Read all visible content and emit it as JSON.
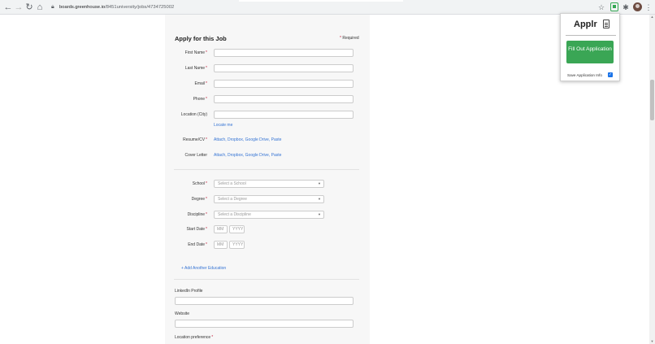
{
  "browser": {
    "url_host": "boards.greenhouse.io",
    "url_path": "/8451university/jobs/4734725002",
    "icons": [
      "back-arrow-icon",
      "forward-arrow-icon",
      "reload-icon",
      "home-icon",
      "lock-icon",
      "star-icon",
      "puzzle-icon",
      "menu-icon"
    ]
  },
  "form": {
    "title": "Apply for this Job",
    "required_note": "Required",
    "required_mark": "*",
    "fields": {
      "first_name": "First Name",
      "last_name": "Last Name",
      "email": "Email",
      "phone": "Phone",
      "location": "Location (City)"
    },
    "locate_me": "Locate me",
    "resume_label": "Resume/CV",
    "cover_letter_label": "Cover Letter",
    "attach_links": {
      "attach": "Attach",
      "dropbox": "Dropbox",
      "google_drive": "Google Drive",
      "paste": "Paste",
      "sep": ", "
    },
    "education": {
      "school_label": "School",
      "school_placeholder": "Select a School",
      "degree_label": "Degree",
      "degree_placeholder": "Select a Degree",
      "discipline_label": "Discipline",
      "discipline_placeholder": "Select a Discipline",
      "start_date_label": "Start Date",
      "end_date_label": "End Date",
      "month_placeholder": "MM",
      "year_placeholder": "YYYY",
      "caret": "▼",
      "add_another": "+ Add Another Education"
    },
    "linkedin_label": "LinkedIn Profile",
    "website_label": "Website",
    "location_pref_label": "Location preference"
  },
  "applr_popup": {
    "title": "Applr",
    "fill_button": "Fill Out Application",
    "save_info_label": "Save Application Info",
    "save_info_checked": true,
    "accent_color": "#3aa655"
  },
  "colors": {
    "link": "#3574d4",
    "required": "#c41e3a",
    "card_bg": "#f7f7f7"
  }
}
